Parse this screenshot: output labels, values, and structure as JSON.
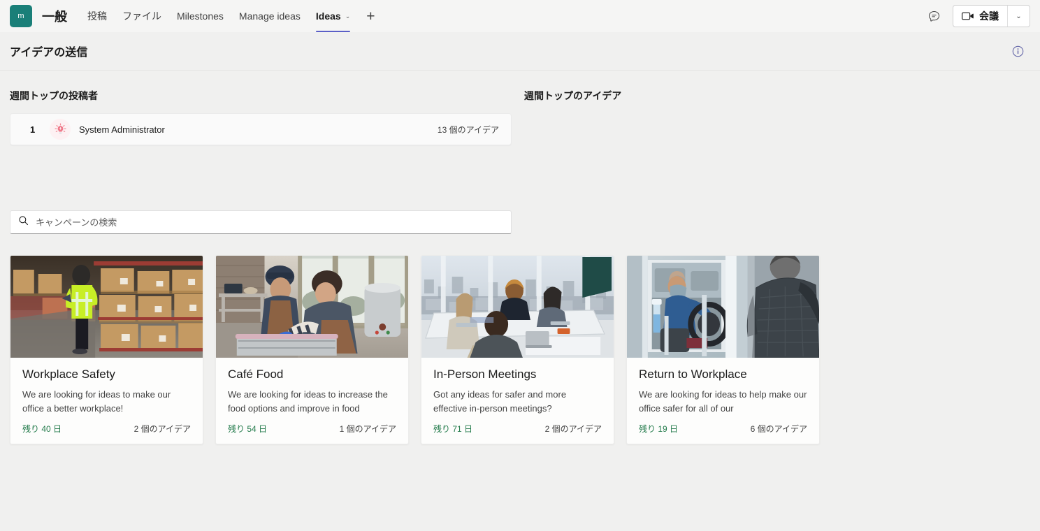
{
  "topbar": {
    "team_initial": "m",
    "channel_name": "一般",
    "tabs": [
      {
        "label": "投稿",
        "active": false,
        "has_chevron": false
      },
      {
        "label": "ファイル",
        "active": false,
        "has_chevron": false
      },
      {
        "label": "Milestones",
        "active": false,
        "has_chevron": false
      },
      {
        "label": "Manage ideas",
        "active": false,
        "has_chevron": false
      },
      {
        "label": "Ideas",
        "active": true,
        "has_chevron": true
      }
    ],
    "add_tab_label": "+",
    "chevron_glyph": "⌄",
    "meeting_label": "会議",
    "meeting_split_glyph": "⌄",
    "chat_icon_name": "chat-bubble-icon"
  },
  "header": {
    "title": "アイデアの送信",
    "info_icon_name": "info-icon",
    "info_color": "#6264a7"
  },
  "leaderboard": {
    "title": "週間トップの投稿者",
    "rows": [
      {
        "rank": "1",
        "name": "System Administrator",
        "count": "13 個のアイデア",
        "avatar_icon": "lightbulb-icon"
      }
    ]
  },
  "top_ideas": {
    "title": "週間トップのアイデア",
    "items": []
  },
  "search": {
    "placeholder": "キャンペーンの検索",
    "value": "",
    "icon_name": "search-icon"
  },
  "campaigns": [
    {
      "title": "Workplace Safety",
      "description": "We are looking for ideas to make our office a better workplace!",
      "days_left": "残り 40 日",
      "idea_count": "2 個のアイデア",
      "image_name": "warehouse-worker-photo"
    },
    {
      "title": "Café Food",
      "description": "We are looking for ideas to increase the food options and improve in food",
      "days_left": "残り 54 日",
      "idea_count": "1 個のアイデア",
      "image_name": "cafe-kitchen-photo"
    },
    {
      "title": "In-Person Meetings",
      "description": "Got any ideas for safer and more effective in-person meetings?",
      "days_left": "残り 71 日",
      "idea_count": "2 個のアイデア",
      "image_name": "conference-room-photo"
    },
    {
      "title": "Return to Workplace",
      "description": "We are looking for ideas to help make our office safer for all of our",
      "days_left": "残り 19 日",
      "idea_count": "6 個のアイデア",
      "image_name": "bus-driver-photo"
    }
  ],
  "colors": {
    "accent": "#5b5fc7",
    "team_avatar": "#1a7f78",
    "days_green": "#237b4b",
    "page_bg": "#f0f0ef"
  }
}
